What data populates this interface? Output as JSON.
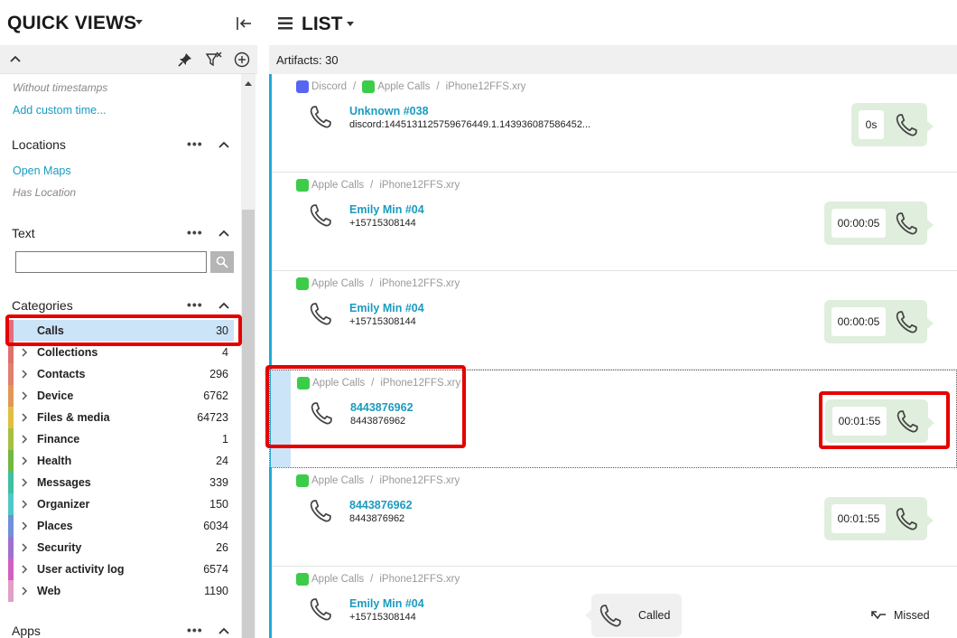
{
  "quick_views": {
    "title": "QUICK VIEWS",
    "filters": {
      "without_timestamps": "Without timestamps",
      "add_custom_time": "Add custom time..."
    },
    "locations": {
      "title": "Locations",
      "dots": "•••",
      "open_maps": "Open Maps",
      "has_location": "Has Location"
    },
    "text": {
      "title": "Text",
      "dots": "•••",
      "input_value": ""
    },
    "categories": {
      "title": "Categories",
      "dots": "•••",
      "items": [
        {
          "label": "Calls",
          "count": "30",
          "color": "#e07080"
        },
        {
          "label": "Collections",
          "count": "4",
          "color": "#e07070"
        },
        {
          "label": "Contacts",
          "count": "296",
          "color": "#e08070"
        },
        {
          "label": "Device",
          "count": "6762",
          "color": "#e09858"
        },
        {
          "label": "Files & media",
          "count": "64723",
          "color": "#e0c040"
        },
        {
          "label": "Finance",
          "count": "1",
          "color": "#a8c040"
        },
        {
          "label": "Health",
          "count": "24",
          "color": "#70b840"
        },
        {
          "label": "Messages",
          "count": "339",
          "color": "#40c0a0"
        },
        {
          "label": "Organizer",
          "count": "150",
          "color": "#50c8c8"
        },
        {
          "label": "Places",
          "count": "6034",
          "color": "#7090d8"
        },
        {
          "label": "Security",
          "count": "26",
          "color": "#a070d0"
        },
        {
          "label": "User activity log",
          "count": "6574",
          "color": "#d060c0"
        },
        {
          "label": "Web",
          "count": "1190",
          "color": "#e0a0c8"
        }
      ]
    },
    "apps": {
      "title": "Apps",
      "dots": "•••"
    }
  },
  "list": {
    "title": "LIST",
    "artifacts_label": "Artifacts: 30",
    "cards": [
      {
        "crumb_prefix": "Discord",
        "crumb_app": "Apple Calls",
        "crumb_file": "iPhone12FFS.xry",
        "title": "Unknown #038",
        "subtitle": "discord:1445131125759676449.1.143936087586452...",
        "duration": "0s"
      },
      {
        "crumb_app": "Apple Calls",
        "crumb_file": "iPhone12FFS.xry",
        "title": "Emily Min #04",
        "subtitle": "+15715308144",
        "duration": "00:00:05"
      },
      {
        "crumb_app": "Apple Calls",
        "crumb_file": "iPhone12FFS.xry",
        "title": "Emily Min #04",
        "subtitle": "+15715308144",
        "duration": "00:00:05"
      },
      {
        "crumb_app": "Apple Calls",
        "crumb_file": "iPhone12FFS.xry",
        "title": "8443876962",
        "subtitle": "8443876962",
        "duration": "00:01:55"
      },
      {
        "crumb_app": "Apple Calls",
        "crumb_file": "iPhone12FFS.xry",
        "title": "8443876962",
        "subtitle": "8443876962",
        "duration": "00:01:55"
      },
      {
        "crumb_app": "Apple Calls",
        "crumb_file": "iPhone12FFS.xry",
        "title": "Emily Min #04",
        "subtitle": "+15715308144",
        "called": "Called",
        "missed": "Missed"
      }
    ]
  },
  "colors": {
    "accent": "#1eaad6",
    "highlight": "#e50000",
    "selection": "#cce4f7",
    "bubble": "#e0eedd"
  }
}
